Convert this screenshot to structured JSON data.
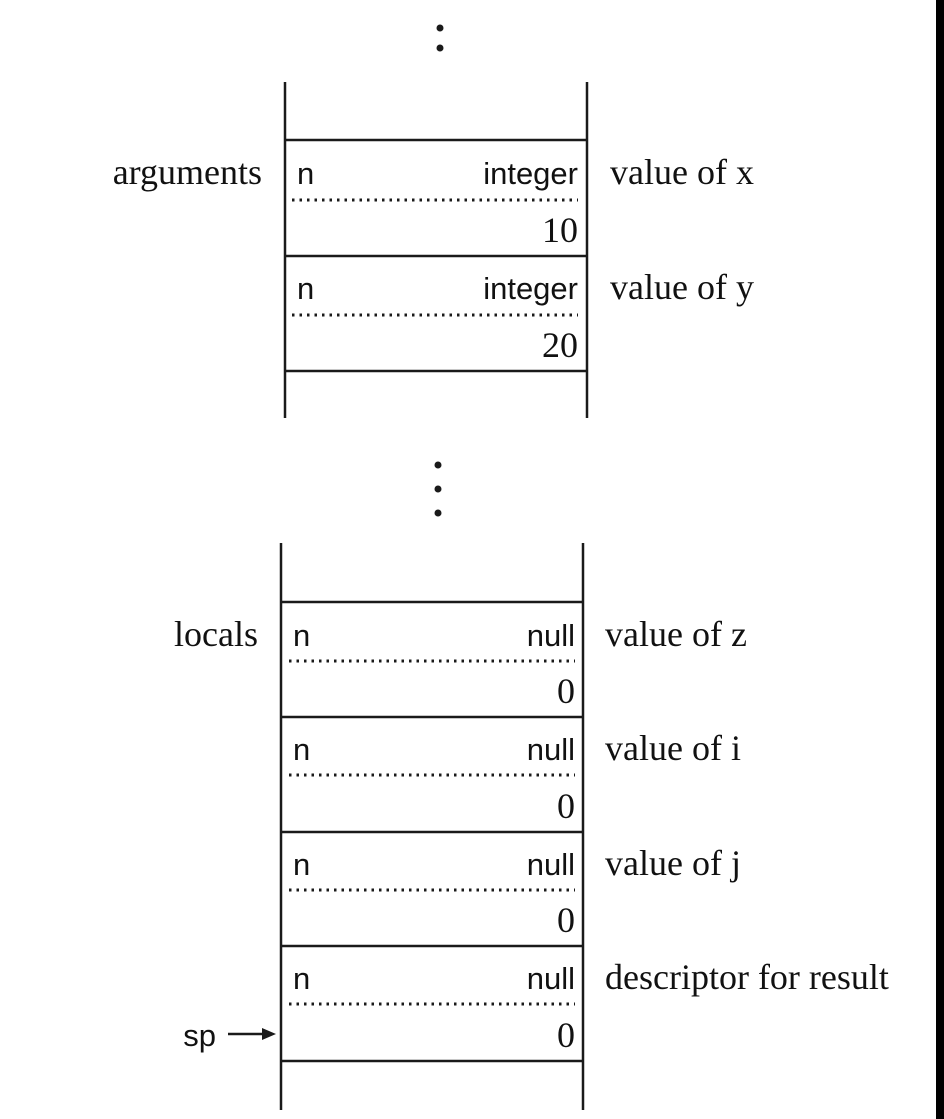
{
  "ellipsis_top": ":",
  "ellipsis_middle": ":",
  "upper_stack": {
    "group_label": "arguments",
    "cells": [
      {
        "left": "n",
        "type": "integer",
        "value": "10",
        "annotation": "value of x"
      },
      {
        "left": "n",
        "type": "integer",
        "value": "20",
        "annotation": "value of y"
      }
    ]
  },
  "lower_stack": {
    "group_label": "locals",
    "cells": [
      {
        "left": "n",
        "type": "null",
        "value": "0",
        "annotation": "value of z"
      },
      {
        "left": "n",
        "type": "null",
        "value": "0",
        "annotation": "value of i"
      },
      {
        "left": "n",
        "type": "null",
        "value": "0",
        "annotation": "value of j"
      },
      {
        "left": "n",
        "type": "null",
        "value": "0",
        "annotation": "descriptor for result"
      }
    ],
    "pointer_label": "sp"
  }
}
